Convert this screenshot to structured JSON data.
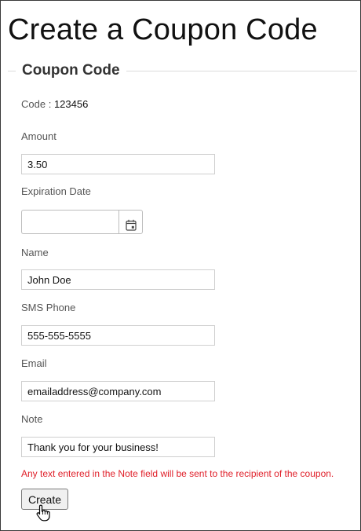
{
  "page": {
    "title": "Create a Coupon Code"
  },
  "form": {
    "legend": "Coupon Code",
    "code_label": "Code :",
    "code_value": "123456",
    "amount_label": "Amount",
    "amount_value": "3.50",
    "expiration_label": "Expiration Date",
    "expiration_value": "",
    "name_label": "Name",
    "name_value": "John Doe",
    "sms_label": "SMS Phone",
    "sms_value": "555-555-5555",
    "email_label": "Email",
    "email_value": "emailaddress@company.com",
    "note_label": "Note",
    "note_value": "Thank you for your business!",
    "note_warning": "Any text entered in the Note field will be sent to the recipient of the coupon.",
    "create_label": "Create"
  },
  "icons": {
    "date_picker": "calendar-icon",
    "pointer": "hand-pointer-icon"
  },
  "colors": {
    "warning": "#e0202a",
    "legend_text": "#333333",
    "label_text": "#555555"
  }
}
